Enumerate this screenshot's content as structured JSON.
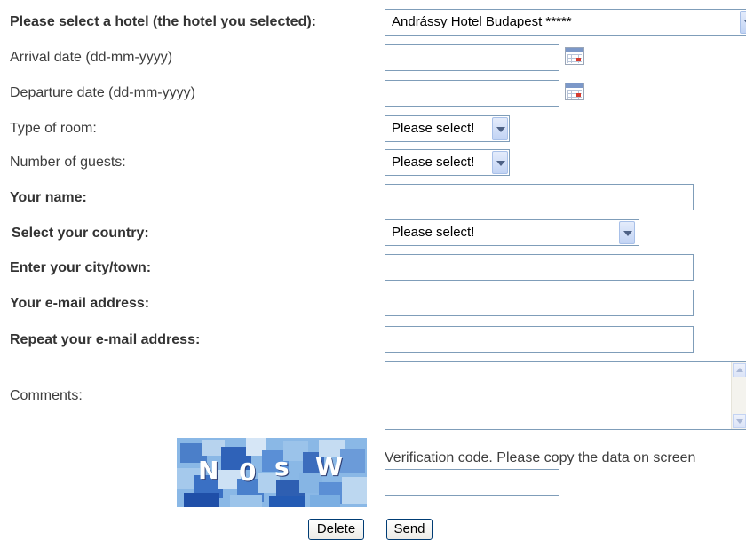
{
  "form": {
    "hotel_label": "Please select a hotel (the hotel you selected):",
    "hotel_value": "Andrássy Hotel Budapest *****",
    "arrival_label": "Arrival date (dd-mm-yyyy)",
    "arrival_value": "",
    "departure_label": "Departure date (dd-mm-yyyy)",
    "departure_value": "",
    "room_type_label": "Type of room:",
    "room_type_value": "Please select!",
    "guests_label": "Number of guests:",
    "guests_value": "Please select!",
    "name_label": "Your name:",
    "name_value": "",
    "country_label": "Select your country:",
    "country_value": "Please select!",
    "city_label": "Enter your city/town:",
    "city_value": "",
    "email_label": "Your e-mail address:",
    "email_value": "",
    "email_repeat_label": "Repeat your e-mail address:",
    "email_repeat_value": "",
    "comments_label": "Comments:",
    "comments_value": "",
    "verification_text": "Verification code. Please copy the data on screen",
    "verification_value": "",
    "captcha_text": "N0sW",
    "delete_label": "Delete",
    "send_label": "Send"
  },
  "icons": {
    "calendar": "calendar-icon",
    "dropdown": "chevron-down-icon"
  },
  "colors": {
    "input_border": "#7f9db9",
    "button_border": "#003c74",
    "label": "#3d3d3d"
  }
}
